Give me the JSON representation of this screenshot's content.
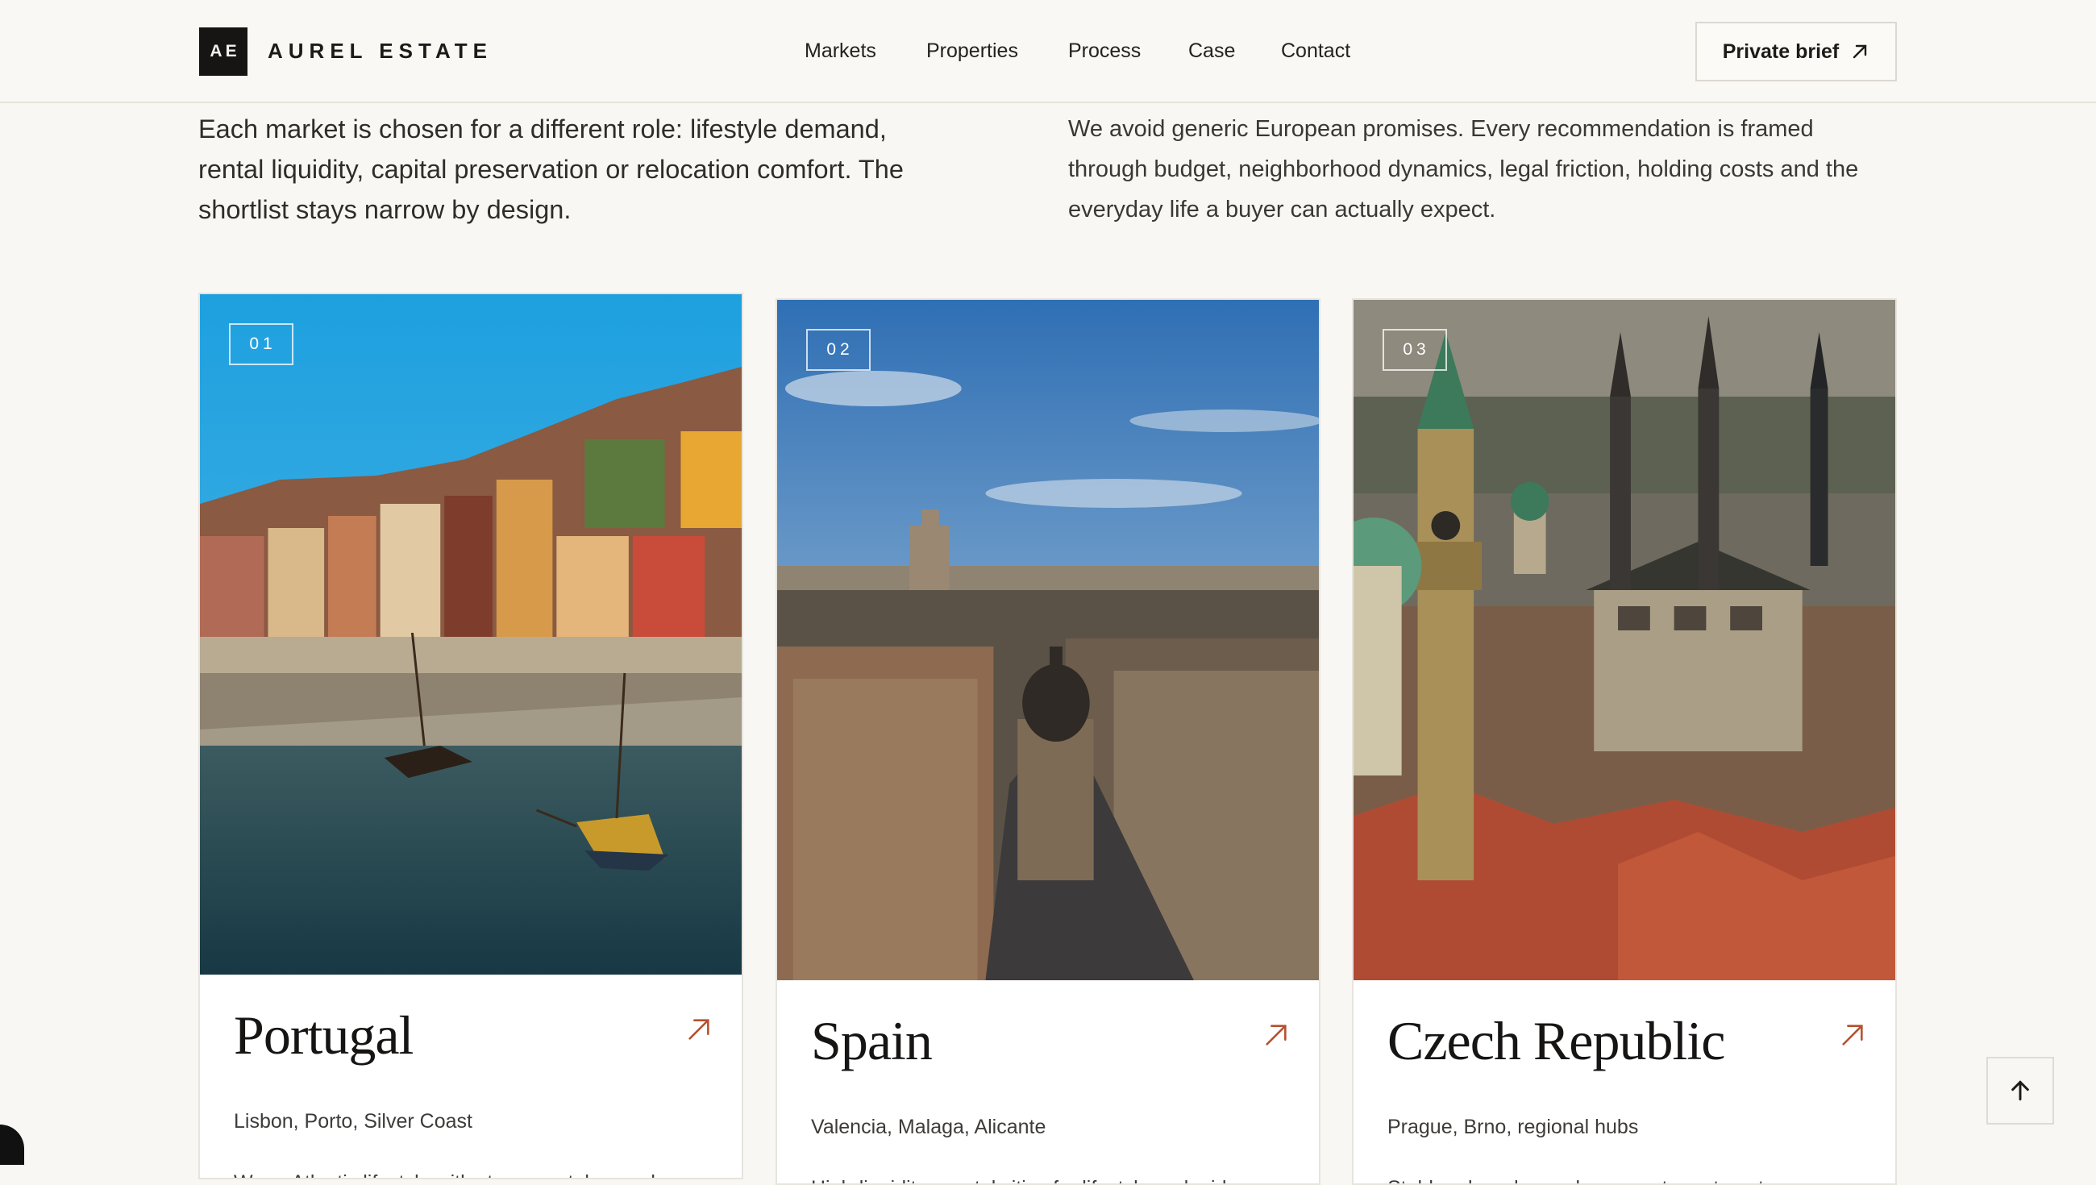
{
  "header": {
    "logo_mark": "AE",
    "brand_name": "AUREL ESTATE",
    "nav": [
      {
        "label": "Markets"
      },
      {
        "label": "Properties"
      },
      {
        "label": "Process"
      },
      {
        "label": "Case"
      },
      {
        "label": "Contact"
      }
    ],
    "cta_label": "Private brief",
    "cta_icon": "arrow-up-right-icon"
  },
  "intro": {
    "left_lines": [
      "Each market is chosen for a different role: lifestyle demand,",
      "rental liquidity, capital preservation or relocation comfort. The",
      "shortlist stays narrow by design."
    ],
    "right_lines": [
      "We avoid generic European promises. Every recommendation is framed",
      "through budget, neighborhood dynamics, legal friction, holding costs and the",
      "everyday life a buyer can actually expect."
    ]
  },
  "markets": [
    {
      "number": "01",
      "title": "Portugal",
      "subtitle": "Lisbon, Porto, Silver Coast",
      "description": "Warm Atlantic lifestyle with strong rental appeal.",
      "icon": "arrow-up-right-icon"
    },
    {
      "number": "02",
      "title": "Spain",
      "subtitle": "Valencia, Malaga, Alicante",
      "description": "High-liquidity coastal cities for lifestyle and mid-",
      "icon": "arrow-up-right-icon"
    },
    {
      "number": "03",
      "title": "Czech Republic",
      "subtitle": "Prague, Brno, regional hubs",
      "description": "Stable urban demand, compact apartments,",
      "icon": "arrow-up-right-icon"
    }
  ],
  "scroll_top_icon": "arrow-up-icon",
  "colors": {
    "background": "#f8f7f3",
    "accent": "#b5502f",
    "logo_bg": "#161514"
  }
}
